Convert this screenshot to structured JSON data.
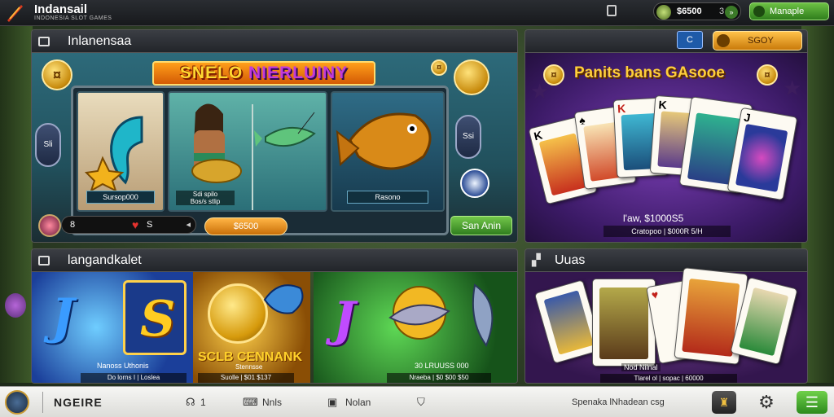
{
  "header": {
    "brand": "Indansail",
    "brand_sub": "INDONESIA SLOT GAMES",
    "coin_value": "$6500",
    "coin_count": "3",
    "coin_go": "»",
    "manage_label": "Manaple",
    "window_icon": "square-icon"
  },
  "panels": {
    "slot": {
      "title": "Inlanensaa",
      "game_title_a": "SNELO ",
      "game_title_b": "NIERLUINY",
      "left_side_label": "Sli",
      "right_side_label": "Ssi",
      "reel_1_label": "Sursop000",
      "reel_2_label_a": "Sdi spilo",
      "reel_2_label_b": "Bos/s stlip",
      "reel_3_label": "Rasono",
      "bet_left": "8",
      "bet_right": "S",
      "spin_value": "$6500",
      "start_label": "San Anin"
    },
    "poker": {
      "header_btn": "C",
      "header_btn2": "SGOY",
      "title": "Panits bans GAsooe",
      "cards": [
        "K",
        "♠",
        "K",
        "K",
        "",
        "J"
      ],
      "info_1": "l'aw, $1000S5",
      "info_2": "Cratopoo | $000R 5/H"
    },
    "arcade": {
      "title": "langandkalet",
      "tile1_caption_a": "Nanoss Uthonis",
      "tile1_caption_b": "Do lorns I | Loslea",
      "gold_title": "SCLB CENNANK",
      "gold_sub": "Stennsse",
      "gold_bar": "Suolle | $01 $137",
      "green_caption_a": "30 LRUUSS 000",
      "green_caption_b": "Nraeba | $0 $00 $50"
    },
    "cards": {
      "title": "Uuas",
      "info_1": "Nod Nilnal",
      "info_2": "Tlarel ol | sopac | 60000"
    }
  },
  "bottom": {
    "brand": "NGEIRE",
    "item_1": "1",
    "item_2": "Nnls",
    "item_3": "Nolan",
    "right_text": "Spenaka lNhadean csg"
  },
  "colors": {
    "accent_green": "#4aa62c",
    "accent_gold": "#ffc24a",
    "poker_purple": "#5a2a8e"
  }
}
